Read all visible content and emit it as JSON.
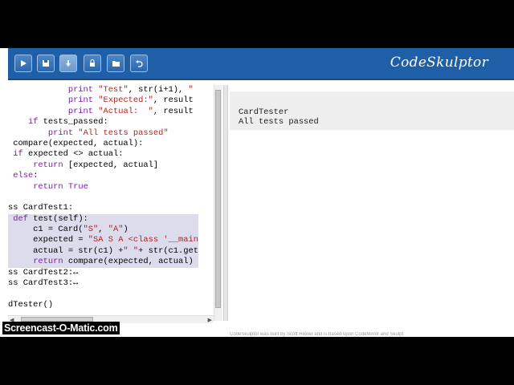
{
  "app": {
    "logo": "CodeSkulptor"
  },
  "toolbar": {
    "buttons": [
      {
        "name": "run-button",
        "icon": "play-icon"
      },
      {
        "name": "save-button",
        "icon": "floppy-icon"
      },
      {
        "name": "download-button",
        "icon": "download-icon"
      },
      {
        "name": "reset-button",
        "icon": "lock-icon"
      },
      {
        "name": "open-button",
        "icon": "folder-icon"
      },
      {
        "name": "undo-button",
        "icon": "undo-icon"
      }
    ]
  },
  "editor": {
    "lines": [
      {
        "text": "            print \"Test\", str(i+1), \"",
        "selected": false
      },
      {
        "text": "            print \"Expected:\", result",
        "selected": false
      },
      {
        "text": "            print \"Actual:  \", result",
        "selected": false
      },
      {
        "text": "    if tests_passed:",
        "selected": false
      },
      {
        "text": "        print \"All tests passed\"",
        "selected": false
      },
      {
        "text": " compare(expected, actual):",
        "selected": false
      },
      {
        "text": " if expected <> actual:",
        "selected": false
      },
      {
        "text": "     return [expected, actual]",
        "selected": false
      },
      {
        "text": " else:",
        "selected": false
      },
      {
        "text": "     return True",
        "selected": false
      },
      {
        "text": "",
        "selected": false
      },
      {
        "text": "ss CardTest1:",
        "selected": false
      },
      {
        "text": " def test(self):",
        "selected": true
      },
      {
        "text": "     c1 = Card(\"S\", \"A\")",
        "selected": true
      },
      {
        "text": "     expected = \"SA S A <class '__main",
        "selected": true
      },
      {
        "text": "     actual = str(c1) +\" \"+ str(c1.get",
        "selected": true
      },
      {
        "text": "     return compare(expected, actual)",
        "selected": true
      },
      {
        "text": "ss CardTest2:↔",
        "selected": false
      },
      {
        "text": "ss CardTest3:↔",
        "selected": false
      },
      {
        "text": "",
        "selected": false
      },
      {
        "text": "dTester()",
        "selected": false
      }
    ]
  },
  "output": {
    "lines": [
      "CardTester",
      "All tests passed"
    ]
  },
  "footer": {
    "text": "CodeSkulptor was built by Scott Rixner and is based upon CodeMirror and Skulpt"
  },
  "watermark": "Screencast-O-Matic.com",
  "colors": {
    "toolbar": "#1f5fa8",
    "selection": "#dcdcec",
    "keyword": "#7a1fa0",
    "string": "#b22222"
  }
}
